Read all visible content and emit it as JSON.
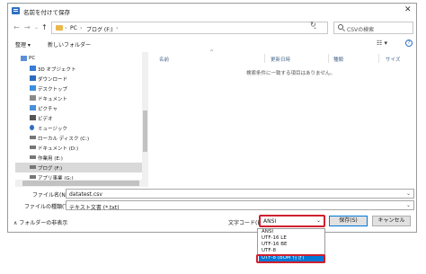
{
  "window": {
    "title": "名前を付けて保存",
    "close_glyph": "✕"
  },
  "address": {
    "back": "←",
    "forward": "→",
    "recent": "⌄",
    "up": "↑",
    "crumbs": [
      "PC",
      "›",
      "ブログ (F:)",
      "›"
    ],
    "dropdown": "⌄",
    "refresh": "↻",
    "search_placeholder": "CSVの検索"
  },
  "toolbar": {
    "organize": "整理 ▾",
    "new_folder": "新しいフォルダー",
    "view": "☷ ▾",
    "help": "?"
  },
  "nav": {
    "items": [
      {
        "label": "PC",
        "color": "#5b8fd9"
      },
      {
        "label": "3D オブジェクト",
        "color": "#3a7bd5"
      },
      {
        "label": "ダウンロード",
        "color": "#2e6cc0"
      },
      {
        "label": "デスクトップ",
        "color": "#3a8fe0"
      },
      {
        "label": "ドキュメント",
        "color": "#8a8a8a"
      },
      {
        "label": "ピクチャ",
        "color": "#4a90d9"
      },
      {
        "label": "ビデオ",
        "color": "#555555"
      },
      {
        "label": "ミュージック",
        "color": "#2e6cc0"
      },
      {
        "label": "ローカル ディスク (C:)",
        "color": "#777777"
      },
      {
        "label": "ドキュメント (D:)",
        "color": "#777777"
      },
      {
        "label": "作業用 (E:)",
        "color": "#777777"
      },
      {
        "label": "ブログ (F:)",
        "color": "#777777",
        "selected": true
      },
      {
        "label": "アプリ事業 (G:)",
        "color": "#777777"
      }
    ]
  },
  "files": {
    "columns": [
      "名前",
      "更新日時",
      "種類",
      "サイズ"
    ],
    "sort_caret": "^",
    "empty_message": "検索条件に一致する項目はありません。"
  },
  "form": {
    "filename_label": "ファイル名(N):",
    "filename_value": "datatest.csv",
    "filetype_label": "ファイルの種類(T):",
    "filetype_value": "テキスト文書 (*.txt)",
    "dropdown": "⌄"
  },
  "footer": {
    "hide_folders": "∧ フォルダーの非表示",
    "encoding_label": "文字コード(E):",
    "encoding_value": "ANSI",
    "encoding_options": [
      "ANSI",
      "UTF-16 LE",
      "UTF-16 BE",
      "UTF-8",
      "UTF-8 (BOM 付き)"
    ],
    "save": "保存(S)",
    "cancel": "キャンセル"
  },
  "colors": {
    "accent": "#0078d7",
    "highlight_border": "#d01f2f"
  }
}
